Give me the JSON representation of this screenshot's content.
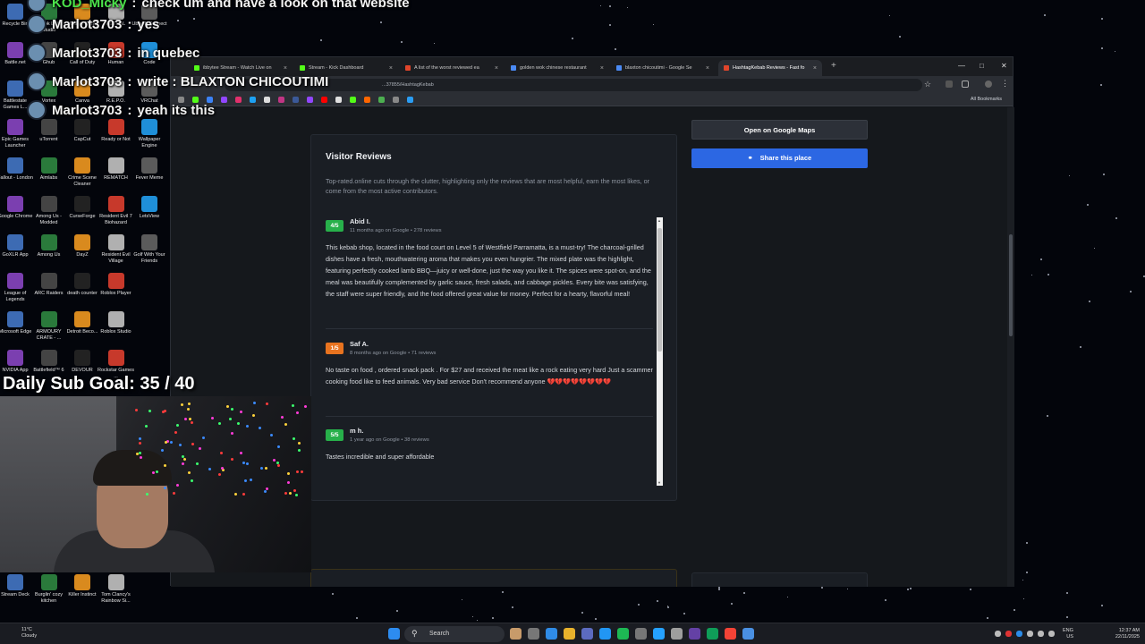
{
  "chat": [
    {
      "user": "KOD_Micky",
      "message": "check um and have a look on that website",
      "green": true
    },
    {
      "user": "Marlot3703",
      "message": "yes",
      "green": false
    },
    {
      "user": "Marlot3703",
      "message": "in quebec",
      "green": false
    },
    {
      "user": "Marlot3703",
      "message": "write : BLAXTON CHICOUTIMI",
      "green": false
    },
    {
      "user": "Marlot3703",
      "message": "yeah its this",
      "green": false
    }
  ],
  "sub_goal": "Daily Sub Goal: 35 / 40",
  "desktop_icons": [
    "Recycle Bin",
    "TikTok LIVE Studio",
    "Call of Duty",
    "ASTRAL",
    "Ubisoft Connect",
    "Battle.net",
    "Ghub",
    "Call of Duty",
    "Human",
    "Code",
    "Battlestate Games L...",
    "Vortex",
    "Canva",
    "R.E.P.O.",
    "VRChat",
    "Epic Games Launcher",
    "uTorrent",
    "CapCut",
    "Ready or Not",
    "Wallpaper Engine",
    "Fallout - London",
    "Aimlabs",
    "Crime Scene Cleaner",
    "REMATCH",
    "Fever Meme",
    "Google Chrome",
    "Among Us - Modded",
    "CurseForge",
    "Resident Evil 7 Biohazard",
    "LetsView",
    "GoXLR App",
    "Among Us",
    "DayZ",
    "Resident Evil Village",
    "Golf With Your Friends",
    "League of Legends",
    "ARC Raiders",
    "death counter",
    "Roblox Player",
    "",
    "Microsoft Edge",
    "ARMOURY CRATE - ...",
    "Detroit Beco...",
    "Roblox Studio",
    "",
    "NVIDIA App",
    "Battlefield™ 6",
    "DEVOUR",
    "Rockstar Games ...",
    "",
    "Stream Deck",
    "Burglin' cozy kitchen",
    "Killer Instinct",
    "Tom Clancy's Rainbow Si...",
    ""
  ],
  "browser": {
    "tabs": [
      {
        "label": "ibbytee Stream - Watch Live on",
        "active": false,
        "color": "#53fc18"
      },
      {
        "label": "Stream - Kick Dashboard",
        "active": false,
        "color": "#53fc18"
      },
      {
        "label": "A list of the worst reviewed ea",
        "active": false,
        "color": "#e0452b"
      },
      {
        "label": "golden wok chinese restaurant",
        "active": false,
        "color": "#4a8af4"
      },
      {
        "label": "blaxton chicoutimi - Google Se",
        "active": false,
        "color": "#4a8af4"
      },
      {
        "label": "HashtagKebab Reviews - Fast fo",
        "active": true,
        "color": "#e0452b"
      }
    ],
    "url": "...37855/HashtagKebab",
    "all_bookmarks": "All Bookmarks"
  },
  "reviews_card": {
    "title": "Visitor Reviews",
    "intro": "Top-rated.online cuts through the clutter, highlighting only the reviews that are most helpful, earn the most likes, or come from the most active contributors.",
    "reviews": [
      {
        "rating": "4/5",
        "rating_color": "#27b04a",
        "name": "Abid I.",
        "meta": "11 months ago on Google • 278 reviews",
        "text": "This kebab shop, located in the food court on Level 5 of Westfield Parramatta, is a must-try! The charcoal-grilled dishes have a fresh, mouthwatering aroma that makes you even hungrier. The mixed plate was the highlight, featuring perfectly cooked lamb BBQ—juicy or well-done, just the way you like it. The spices were spot-on, and the meal was beautifully complemented by garlic sauce, fresh salads, and cabbage pickles. Every bite was satisfying, the staff were super friendly, and the food offered great value for money. Perfect for a hearty, flavorful meal!"
      },
      {
        "rating": "1/5",
        "rating_color": "#e8731f",
        "name": "Saf A.",
        "meta": "8 months ago on Google • 71 reviews",
        "text": "No taste on food , ordered snack pack . For $27 and received the meat like a rock eating very hard Just a scammer cooking food like to feed animals. Very bad service Don't recommend anyone 💔💔💔💔💔💔💔💔"
      },
      {
        "rating": "5/5",
        "rating_color": "#27b04a",
        "name": "m h.",
        "meta": "1 year ago on Google • 38 reviews",
        "text": "Tastes incredible and super affordable"
      }
    ]
  },
  "actions": {
    "maps_label": "Open on Google Maps",
    "share_label": "Share this place"
  },
  "taskbar": {
    "search_placeholder": "Search",
    "weather_temp": "11°C",
    "weather_desc": "Cloudy",
    "lang": "ENG",
    "region": "US",
    "time": "12:37 AM",
    "date": "22/11/2025"
  }
}
